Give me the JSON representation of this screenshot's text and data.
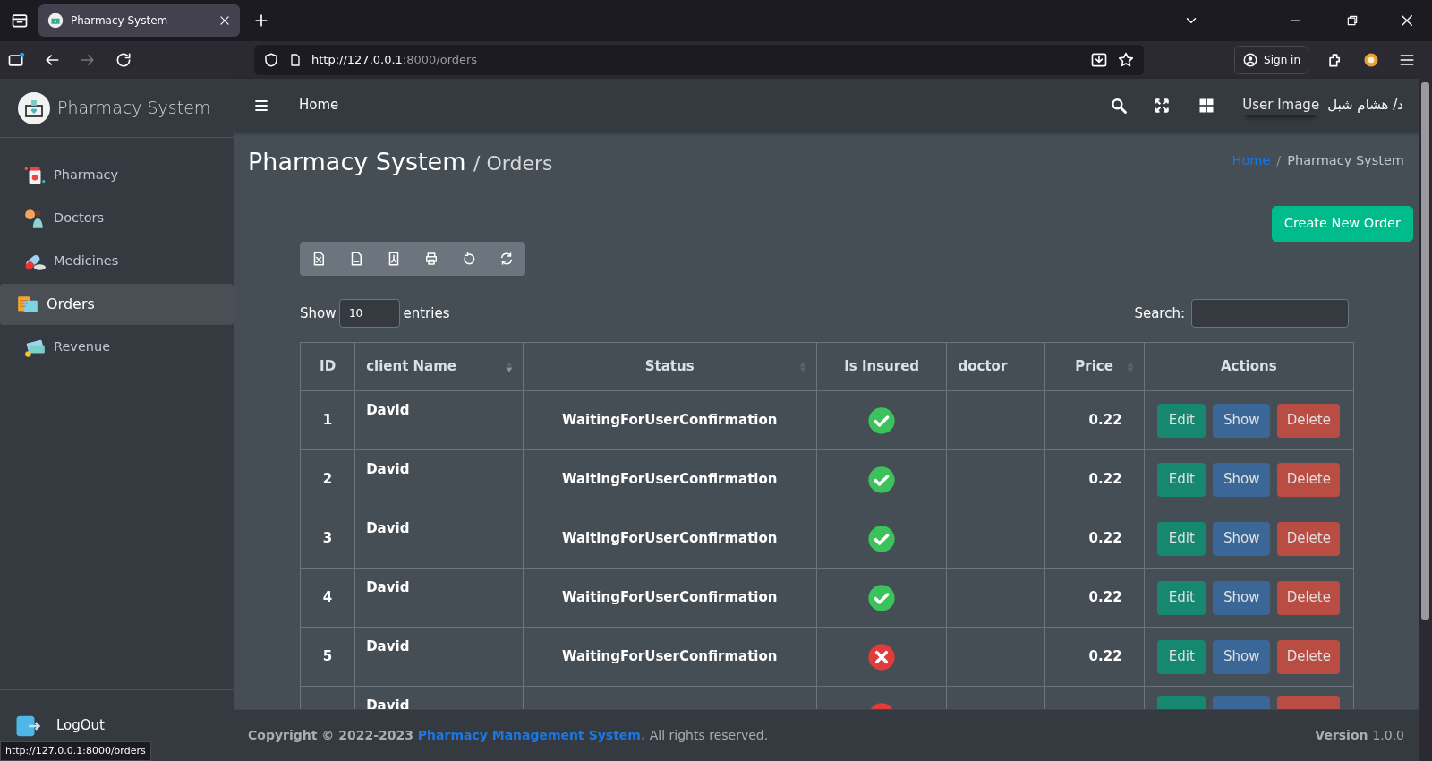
{
  "browser": {
    "tab_title": "Pharmacy System",
    "url_host": "http://127.0.0.1",
    "url_rest": ":8000/orders",
    "sign_in": "Sign in",
    "status_url": "http://127.0.0.1:8000/orders"
  },
  "sidebar": {
    "brand": "Pharmacy System",
    "items": [
      {
        "label": "Pharmacy",
        "kind": "pharmacy",
        "selected": false
      },
      {
        "label": "Doctors",
        "kind": "doctors",
        "selected": false
      },
      {
        "label": "Medicines",
        "kind": "medicines",
        "selected": false
      },
      {
        "label": "Orders",
        "kind": "orders",
        "selected": true
      },
      {
        "label": "Revenue",
        "kind": "revenue",
        "selected": false
      }
    ],
    "logout": "LogOut"
  },
  "topbar": {
    "home": "Home",
    "user_image": "User Image",
    "user_name": "د/ هشام شبل"
  },
  "header": {
    "title": "Pharmacy System",
    "subtitle": "/ Orders",
    "breadcrumb": [
      {
        "label": "Home",
        "link": true
      },
      {
        "label": "Pharmacy System",
        "link": false
      }
    ],
    "breadcrumb_separator": "/"
  },
  "create_button": "Create New Order",
  "export_tools": [
    {
      "kind": "excel"
    },
    {
      "kind": "csv"
    },
    {
      "kind": "pdf"
    },
    {
      "kind": "print"
    },
    {
      "kind": "reset"
    },
    {
      "kind": "reload"
    }
  ],
  "length": {
    "before": "Show",
    "value": "10",
    "after": "entries"
  },
  "search_label": "Search:",
  "table": {
    "columns": [
      {
        "label": "ID",
        "sortable": false
      },
      {
        "label": "client Name",
        "sortable": true,
        "sorted_desc": true
      },
      {
        "label": "Status",
        "sortable": true,
        "sorted_desc": false
      },
      {
        "label": "Is Insured",
        "sortable": false
      },
      {
        "label": "doctor",
        "sortable": false
      },
      {
        "label": "Price",
        "sortable": true,
        "sorted_desc": false
      },
      {
        "label": "Actions",
        "sortable": false
      }
    ],
    "rows": [
      {
        "id": "1",
        "client": "David",
        "status": "WaitingForUserConfirmation",
        "insured": true,
        "price": "0.22",
        "actions": [
          {
            "kind": "edit",
            "label": "Edit"
          },
          {
            "kind": "show",
            "label": "Show"
          },
          {
            "kind": "delete",
            "label": "Delete"
          }
        ]
      },
      {
        "id": "2",
        "client": "David",
        "status": "WaitingForUserConfirmation",
        "insured": true,
        "price": "0.22",
        "actions": [
          {
            "kind": "edit",
            "label": "Edit"
          },
          {
            "kind": "show",
            "label": "Show"
          },
          {
            "kind": "delete",
            "label": "Delete"
          }
        ]
      },
      {
        "id": "3",
        "client": "David",
        "status": "WaitingForUserConfirmation",
        "insured": true,
        "price": "0.22",
        "actions": [
          {
            "kind": "edit",
            "label": "Edit"
          },
          {
            "kind": "show",
            "label": "Show"
          },
          {
            "kind": "delete",
            "label": "Delete"
          }
        ]
      },
      {
        "id": "4",
        "client": "David",
        "status": "WaitingForUserConfirmation",
        "insured": true,
        "price": "0.22",
        "actions": [
          {
            "kind": "edit",
            "label": "Edit"
          },
          {
            "kind": "show",
            "label": "Show"
          },
          {
            "kind": "delete",
            "label": "Delete"
          }
        ]
      },
      {
        "id": "5",
        "client": "David",
        "status": "WaitingForUserConfirmation",
        "insured": false,
        "price": "0.22",
        "actions": [
          {
            "kind": "edit",
            "label": "Edit"
          },
          {
            "kind": "show",
            "label": "Show"
          },
          {
            "kind": "delete",
            "label": "Delete"
          }
        ]
      },
      {
        "client": "David",
        "insured": false,
        "actions": [
          {
            "kind": "edit"
          },
          {
            "kind": "show"
          },
          {
            "kind": "delete"
          }
        ]
      }
    ]
  },
  "footer": {
    "copyright": "Copyright © 2022-2023",
    "link": "Pharmacy Management System.",
    "rights": "All rights reserved.",
    "version_label": "Version",
    "version": "1.0.0"
  }
}
